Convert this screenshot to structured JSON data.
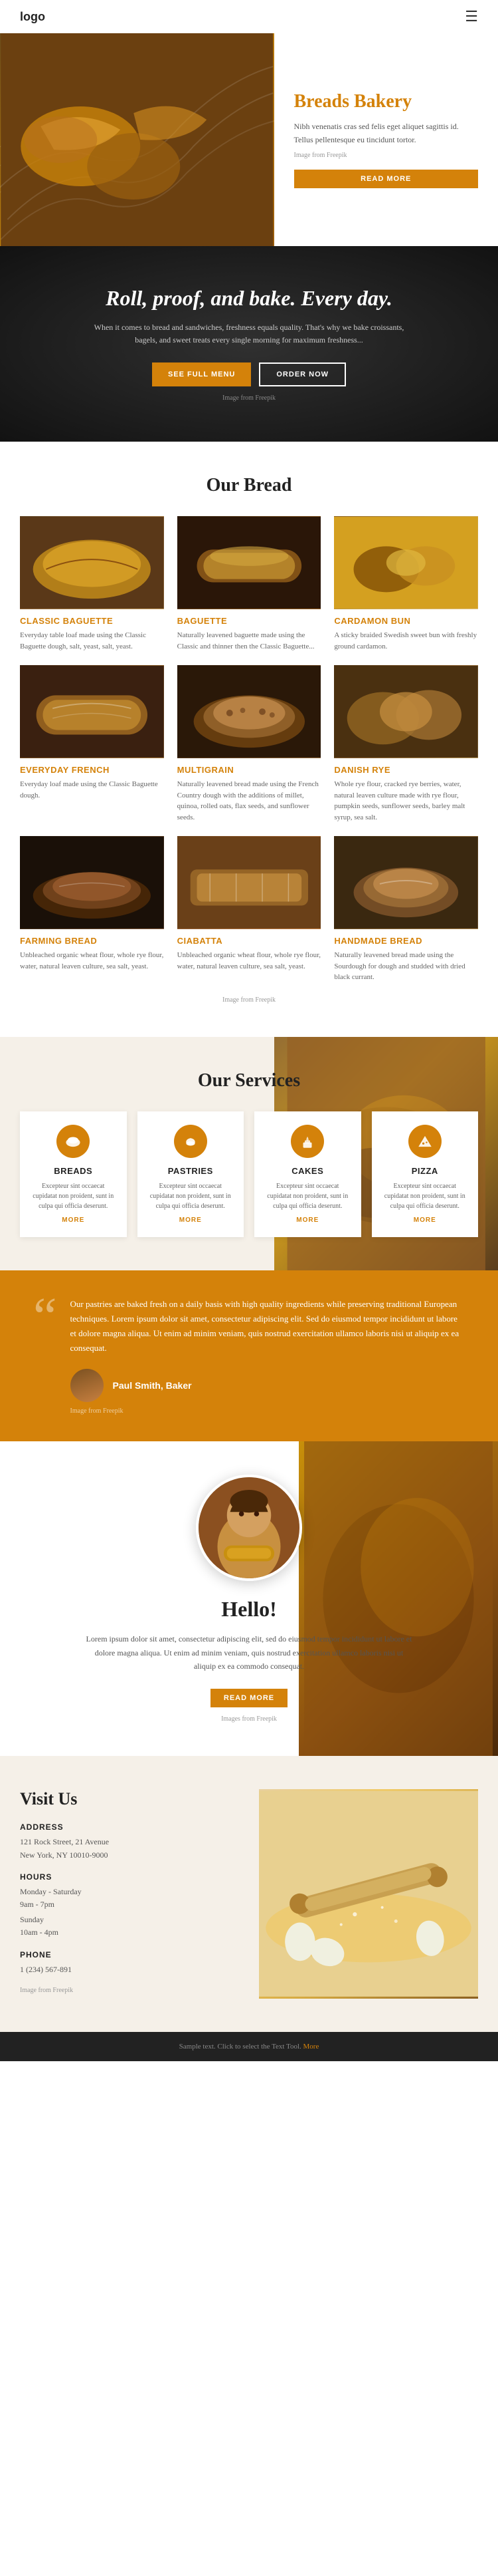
{
  "nav": {
    "logo": "logo",
    "menu_icon": "☰"
  },
  "hero": {
    "title": "Breads Bakery",
    "description": "Nibh venenatis cras sed felis eget aliquet sagittis id. Tellus pellentesque eu tincidunt tortor.",
    "image_credit": "Image from Freepik",
    "read_more_label": "READ MORE"
  },
  "fullmenu": {
    "title": "Roll, proof, and bake. Every day.",
    "description": "When it comes to bread and sandwiches, freshness equals quality. That's why we bake croissants, bagels, and sweet treats every single morning for maximum freshness...",
    "see_menu_label": "SEE FULL MENU",
    "order_label": "ORDER NOW",
    "credit": "Image from Freepik"
  },
  "our_bread": {
    "section_title": "Our Bread",
    "items": [
      {
        "name": "Classic Baguette",
        "description": "Everyday table loaf made using the Classic Baguette dough, salt, yeast, salt, yeast.",
        "img_class": "bi-1"
      },
      {
        "name": "Baguette",
        "description": "Naturally leavened baguette made using the Classic and thinner then the Classic Baguette...",
        "img_class": "bi-2"
      },
      {
        "name": "Cardamon Bun",
        "description": "A sticky braided Swedish sweet bun with freshly ground cardamon.",
        "img_class": "bi-3"
      },
      {
        "name": "Everyday French",
        "description": "Everyday loaf made using the Classic Baguette dough.",
        "img_class": "bi-4"
      },
      {
        "name": "Multigrain",
        "description": "Naturally leavened bread made using the French Country dough with the additions of millet, quinoa, rolled oats, flax seeds, and sunflower seeds.",
        "img_class": "bi-5"
      },
      {
        "name": "Danish Rye",
        "description": "Whole rye flour, cracked rye berries, water, natural leaven culture made with rye flour, pumpkin seeds, sunflower seeds, barley malt syrup, sea salt.",
        "img_class": "bi-6"
      },
      {
        "name": "Farming Bread",
        "description": "Unbleached organic wheat flour, whole rye flour, water, natural leaven culture, sea salt, yeast.",
        "img_class": "bi-7"
      },
      {
        "name": "Ciabatta",
        "description": "Unbleached organic wheat flour, whole rye flour, water, natural leaven culture, sea salt, yeast.",
        "img_class": "bi-8"
      },
      {
        "name": "Handmade Bread",
        "description": "Naturally leavened bread made using the Sourdough for dough and studded with dried black currant.",
        "img_class": "bi-9"
      }
    ],
    "credit": "Image from Freepik"
  },
  "services": {
    "section_title": "Our Services",
    "items": [
      {
        "name": "Breads",
        "icon": "🍞",
        "description": "Excepteur sint occaecat cupidatat non proident, sunt in culpa qui officia deserunt.",
        "more_label": "MORE"
      },
      {
        "name": "Pastries",
        "icon": "🥐",
        "description": "Excepteur sint occaecat cupidatat non proident, sunt in culpa qui officia deserunt.",
        "more_label": "MORE"
      },
      {
        "name": "Cakes",
        "icon": "🎂",
        "description": "Excepteur sint occaecat cupidatat non proident, sunt in culpa qui officia deserunt.",
        "more_label": "MORE"
      },
      {
        "name": "Pizza",
        "icon": "🍕",
        "description": "Excepteur sint occaecat cupidatat non proident, sunt in culpa qui officia deserunt.",
        "more_label": "MORE"
      }
    ]
  },
  "quote": {
    "mark": "“",
    "text": "Our pastries are baked fresh on a daily basis with high quality ingredients while preserving traditional European techniques. Lorem ipsum dolor sit amet, consectetur adipiscing elit. Sed do eiusmod tempor incididunt ut labore et dolore magna aliqua. Ut enim ad minim veniam, quis nostrud exercitation ullamco laboris nisi ut aliquip ex ea consequat.",
    "author_name": "Paul Smith, Baker",
    "credit": "Image from Freepik"
  },
  "hello": {
    "title": "Hello!",
    "description": "Lorem ipsum dolor sit amet, consectetur adipiscing elit, sed do eiusmod tempor incididunt ut labore et dolore magna aliqua. Ut enim ad minim veniam, quis nostrud exercitation ullamco laboris nisi ut aliquip ex ea commodo consequat.",
    "read_more_label": "READ MORE",
    "credit": "Images from Freepik"
  },
  "visit": {
    "title": "Visit Us",
    "address_label": "ADDRESS",
    "address": "121 Rock Street, 21 Avenue\nNew York, NY 10010-9000",
    "hours_label": "HOURS",
    "hours_weekday": "Monday - Saturday",
    "hours_weekday_time": "9am - 7pm",
    "hours_sunday": "Sunday",
    "hours_sunday_time": "10am - 4pm",
    "phone_label": "PHONE",
    "phone": "1 (234) 567-891",
    "credit": "Image from Freepik"
  },
  "footer": {
    "text": "Sample text. Click to select the Text Tool.",
    "link_text": "More"
  }
}
